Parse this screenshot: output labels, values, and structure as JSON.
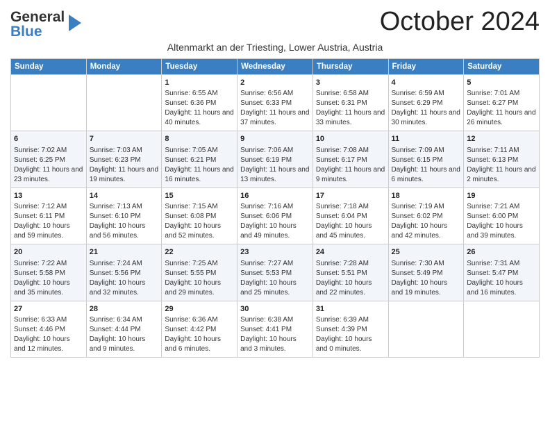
{
  "header": {
    "logo_general": "General",
    "logo_blue": "Blue",
    "month_title": "October 2024",
    "subtitle": "Altenmarkt an der Triesting, Lower Austria, Austria"
  },
  "weekdays": [
    "Sunday",
    "Monday",
    "Tuesday",
    "Wednesday",
    "Thursday",
    "Friday",
    "Saturday"
  ],
  "weeks": [
    [
      {
        "day": "",
        "sunrise": "",
        "sunset": "",
        "daylight": ""
      },
      {
        "day": "",
        "sunrise": "",
        "sunset": "",
        "daylight": ""
      },
      {
        "day": "1",
        "sunrise": "Sunrise: 6:55 AM",
        "sunset": "Sunset: 6:36 PM",
        "daylight": "Daylight: 11 hours and 40 minutes."
      },
      {
        "day": "2",
        "sunrise": "Sunrise: 6:56 AM",
        "sunset": "Sunset: 6:33 PM",
        "daylight": "Daylight: 11 hours and 37 minutes."
      },
      {
        "day": "3",
        "sunrise": "Sunrise: 6:58 AM",
        "sunset": "Sunset: 6:31 PM",
        "daylight": "Daylight: 11 hours and 33 minutes."
      },
      {
        "day": "4",
        "sunrise": "Sunrise: 6:59 AM",
        "sunset": "Sunset: 6:29 PM",
        "daylight": "Daylight: 11 hours and 30 minutes."
      },
      {
        "day": "5",
        "sunrise": "Sunrise: 7:01 AM",
        "sunset": "Sunset: 6:27 PM",
        "daylight": "Daylight: 11 hours and 26 minutes."
      }
    ],
    [
      {
        "day": "6",
        "sunrise": "Sunrise: 7:02 AM",
        "sunset": "Sunset: 6:25 PM",
        "daylight": "Daylight: 11 hours and 23 minutes."
      },
      {
        "day": "7",
        "sunrise": "Sunrise: 7:03 AM",
        "sunset": "Sunset: 6:23 PM",
        "daylight": "Daylight: 11 hours and 19 minutes."
      },
      {
        "day": "8",
        "sunrise": "Sunrise: 7:05 AM",
        "sunset": "Sunset: 6:21 PM",
        "daylight": "Daylight: 11 hours and 16 minutes."
      },
      {
        "day": "9",
        "sunrise": "Sunrise: 7:06 AM",
        "sunset": "Sunset: 6:19 PM",
        "daylight": "Daylight: 11 hours and 13 minutes."
      },
      {
        "day": "10",
        "sunrise": "Sunrise: 7:08 AM",
        "sunset": "Sunset: 6:17 PM",
        "daylight": "Daylight: 11 hours and 9 minutes."
      },
      {
        "day": "11",
        "sunrise": "Sunrise: 7:09 AM",
        "sunset": "Sunset: 6:15 PM",
        "daylight": "Daylight: 11 hours and 6 minutes."
      },
      {
        "day": "12",
        "sunrise": "Sunrise: 7:11 AM",
        "sunset": "Sunset: 6:13 PM",
        "daylight": "Daylight: 11 hours and 2 minutes."
      }
    ],
    [
      {
        "day": "13",
        "sunrise": "Sunrise: 7:12 AM",
        "sunset": "Sunset: 6:11 PM",
        "daylight": "Daylight: 10 hours and 59 minutes."
      },
      {
        "day": "14",
        "sunrise": "Sunrise: 7:13 AM",
        "sunset": "Sunset: 6:10 PM",
        "daylight": "Daylight: 10 hours and 56 minutes."
      },
      {
        "day": "15",
        "sunrise": "Sunrise: 7:15 AM",
        "sunset": "Sunset: 6:08 PM",
        "daylight": "Daylight: 10 hours and 52 minutes."
      },
      {
        "day": "16",
        "sunrise": "Sunrise: 7:16 AM",
        "sunset": "Sunset: 6:06 PM",
        "daylight": "Daylight: 10 hours and 49 minutes."
      },
      {
        "day": "17",
        "sunrise": "Sunrise: 7:18 AM",
        "sunset": "Sunset: 6:04 PM",
        "daylight": "Daylight: 10 hours and 45 minutes."
      },
      {
        "day": "18",
        "sunrise": "Sunrise: 7:19 AM",
        "sunset": "Sunset: 6:02 PM",
        "daylight": "Daylight: 10 hours and 42 minutes."
      },
      {
        "day": "19",
        "sunrise": "Sunrise: 7:21 AM",
        "sunset": "Sunset: 6:00 PM",
        "daylight": "Daylight: 10 hours and 39 minutes."
      }
    ],
    [
      {
        "day": "20",
        "sunrise": "Sunrise: 7:22 AM",
        "sunset": "Sunset: 5:58 PM",
        "daylight": "Daylight: 10 hours and 35 minutes."
      },
      {
        "day": "21",
        "sunrise": "Sunrise: 7:24 AM",
        "sunset": "Sunset: 5:56 PM",
        "daylight": "Daylight: 10 hours and 32 minutes."
      },
      {
        "day": "22",
        "sunrise": "Sunrise: 7:25 AM",
        "sunset": "Sunset: 5:55 PM",
        "daylight": "Daylight: 10 hours and 29 minutes."
      },
      {
        "day": "23",
        "sunrise": "Sunrise: 7:27 AM",
        "sunset": "Sunset: 5:53 PM",
        "daylight": "Daylight: 10 hours and 25 minutes."
      },
      {
        "day": "24",
        "sunrise": "Sunrise: 7:28 AM",
        "sunset": "Sunset: 5:51 PM",
        "daylight": "Daylight: 10 hours and 22 minutes."
      },
      {
        "day": "25",
        "sunrise": "Sunrise: 7:30 AM",
        "sunset": "Sunset: 5:49 PM",
        "daylight": "Daylight: 10 hours and 19 minutes."
      },
      {
        "day": "26",
        "sunrise": "Sunrise: 7:31 AM",
        "sunset": "Sunset: 5:47 PM",
        "daylight": "Daylight: 10 hours and 16 minutes."
      }
    ],
    [
      {
        "day": "27",
        "sunrise": "Sunrise: 6:33 AM",
        "sunset": "Sunset: 4:46 PM",
        "daylight": "Daylight: 10 hours and 12 minutes."
      },
      {
        "day": "28",
        "sunrise": "Sunrise: 6:34 AM",
        "sunset": "Sunset: 4:44 PM",
        "daylight": "Daylight: 10 hours and 9 minutes."
      },
      {
        "day": "29",
        "sunrise": "Sunrise: 6:36 AM",
        "sunset": "Sunset: 4:42 PM",
        "daylight": "Daylight: 10 hours and 6 minutes."
      },
      {
        "day": "30",
        "sunrise": "Sunrise: 6:38 AM",
        "sunset": "Sunset: 4:41 PM",
        "daylight": "Daylight: 10 hours and 3 minutes."
      },
      {
        "day": "31",
        "sunrise": "Sunrise: 6:39 AM",
        "sunset": "Sunset: 4:39 PM",
        "daylight": "Daylight: 10 hours and 0 minutes."
      },
      {
        "day": "",
        "sunrise": "",
        "sunset": "",
        "daylight": ""
      },
      {
        "day": "",
        "sunrise": "",
        "sunset": "",
        "daylight": ""
      }
    ]
  ]
}
